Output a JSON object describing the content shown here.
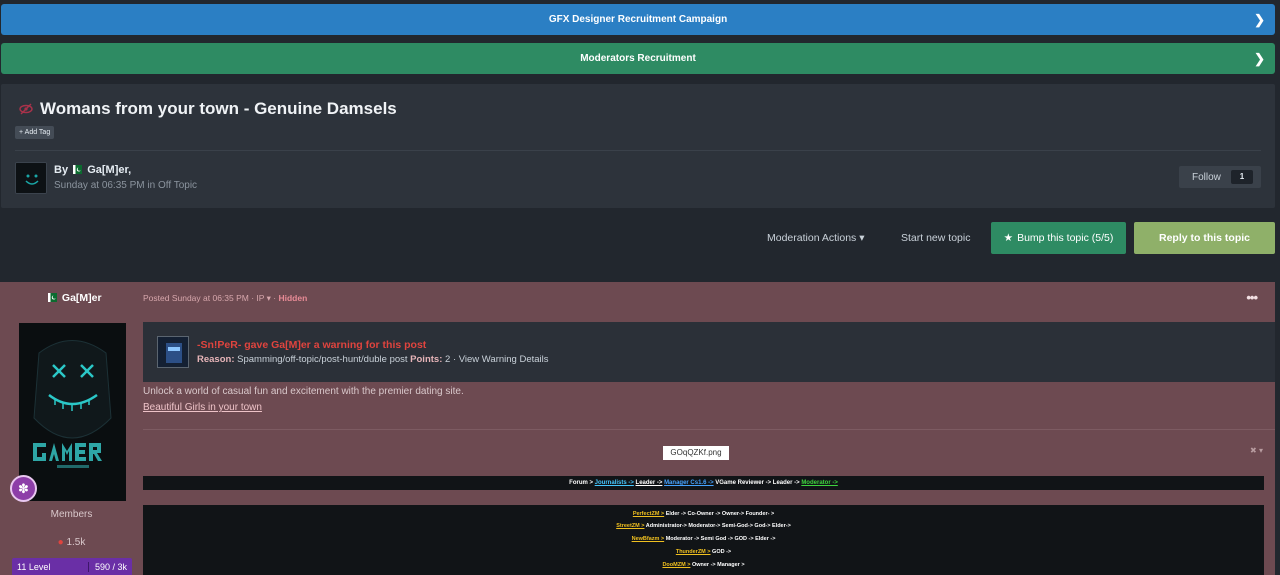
{
  "banners": [
    {
      "label": "GFX Designer Recruitment Campaign",
      "color": "#2b7fc4"
    },
    {
      "label": "Moderators Recruitment",
      "color": "#2e8b63"
    }
  ],
  "topic": {
    "title": "Womans from your town - Genuine Damsels",
    "add_tag": "+ Add Tag",
    "by": "By",
    "author": "Ga[M]er,",
    "date": "Sunday at 06:35 PM in Off Topic",
    "follow_label": "Follow",
    "follow_count": "1"
  },
  "actions": {
    "moderation": "Moderation Actions ▾",
    "start_topic": "Start new topic",
    "bump": "Bump this topic (5/5)",
    "reply": "Reply to this topic"
  },
  "post": {
    "author": "Ga[M]er",
    "group": "Members",
    "posts": "1.5k",
    "level": "11 Level",
    "xp": "590 / 3k",
    "meta_prefix": "Posted Sunday at 06:35 PM · IP ▾ · ",
    "meta_hidden": "Hidden",
    "options_glyph": "•••",
    "warning": {
      "title": "-Sn!PeR- gave Ga[M]er a warning for this post",
      "reason_label": "Reason:",
      "reason": "Spamming/off-topic/post-hunt/duble post",
      "points_label": "Points:",
      "points": "2 · View Warning Details"
    },
    "text": "Unlock a world of casual fun and excitement with the premier dating site.",
    "link": "Beautiful Girls in your town",
    "image_alt": "GOqQZKf.png",
    "image_tools": "✖ ▾"
  },
  "signature": {
    "line1": {
      "forum": "Forum >",
      "journalists": "Journalists ->",
      "leader1": "Leader ->",
      "manager": "Manager Cs1.6 ->",
      "vgame": "VGame Reviewer -> Leader ->",
      "moderator": "Moderator ->"
    },
    "lines": [
      {
        "server": "PerfectZM >",
        "ranks": "Elder -> Co-Owner -> Owner-> Founder- >"
      },
      {
        "server": "StreetZM >",
        "ranks": "Administrator-> Moderator-> Semi-God-> God-> Elder->"
      },
      {
        "server": "NewBfazm >",
        "ranks": "Moderator -> Semi God -> GOD -> Elder ->"
      },
      {
        "server": "ThunderZM >",
        "ranks": "GOD ->"
      },
      {
        "server": "DooMZM >",
        "ranks": "Owner -> Manager >"
      }
    ]
  },
  "colors": {
    "accent_blue": "#2b7fc4",
    "accent_green": "#2e8b63",
    "reply_green": "#8fb069",
    "hidden_post_bg": "#6d4a51",
    "level_purple": "#6a2fa6",
    "warning_red": "#e0443e"
  },
  "icons": [
    "chevron-right-icon",
    "eye-slash-icon",
    "pakistan-flag-icon",
    "star-icon",
    "dots-icon",
    "badge-icon",
    "comment-icon"
  ]
}
